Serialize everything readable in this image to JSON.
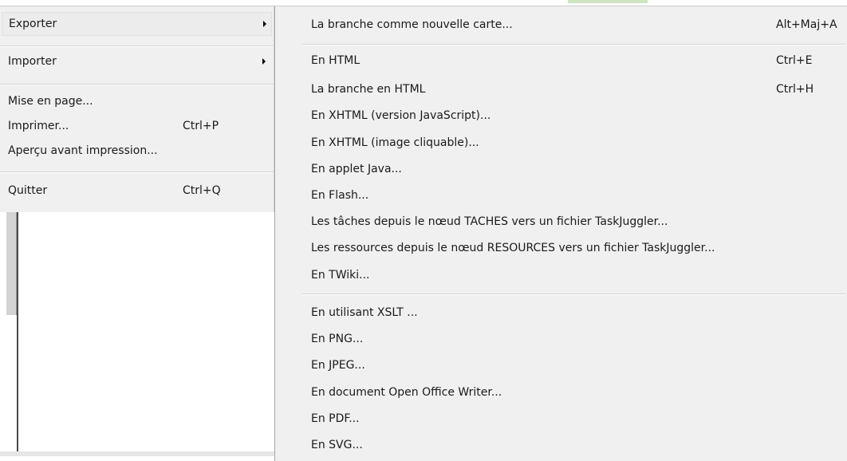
{
  "main_menu": {
    "items": [
      {
        "label": "Exporter",
        "shortcut": "",
        "submenu": true
      },
      {
        "label": "Importer",
        "shortcut": "",
        "submenu": true
      },
      {
        "label": "Mise en page...",
        "shortcut": ""
      },
      {
        "label": "Imprimer...",
        "shortcut": "Ctrl+P"
      },
      {
        "label": "Aperçu avant impression...",
        "shortcut": ""
      },
      {
        "label": "Quitter",
        "shortcut": "Ctrl+Q"
      }
    ]
  },
  "export_submenu": {
    "items": [
      {
        "label": "La branche comme nouvelle carte...",
        "shortcut": "Alt+Maj+A"
      },
      {
        "label": "En HTML",
        "shortcut": "Ctrl+E"
      },
      {
        "label": "La branche en HTML",
        "shortcut": "Ctrl+H"
      },
      {
        "label": "En XHTML (version JavaScript)...",
        "shortcut": ""
      },
      {
        "label": "En XHTML (image cliquable)...",
        "shortcut": ""
      },
      {
        "label": "En applet Java...",
        "shortcut": ""
      },
      {
        "label": "En Flash...",
        "shortcut": ""
      },
      {
        "label": "Les tâches depuis le nœud TACHES vers un fichier TaskJuggler...",
        "shortcut": ""
      },
      {
        "label": "Les ressources depuis le nœud RESOURCES vers un fichier TaskJuggler...",
        "shortcut": ""
      },
      {
        "label": "En TWiki...",
        "shortcut": ""
      },
      {
        "label": "En utilisant XSLT ...",
        "shortcut": ""
      },
      {
        "label": "En PNG...",
        "shortcut": ""
      },
      {
        "label": "En JPEG...",
        "shortcut": ""
      },
      {
        "label": "En document Open Office Writer...",
        "shortcut": ""
      },
      {
        "label": "En PDF...",
        "shortcut": ""
      },
      {
        "label": "En SVG...",
        "shortcut": ""
      }
    ]
  }
}
